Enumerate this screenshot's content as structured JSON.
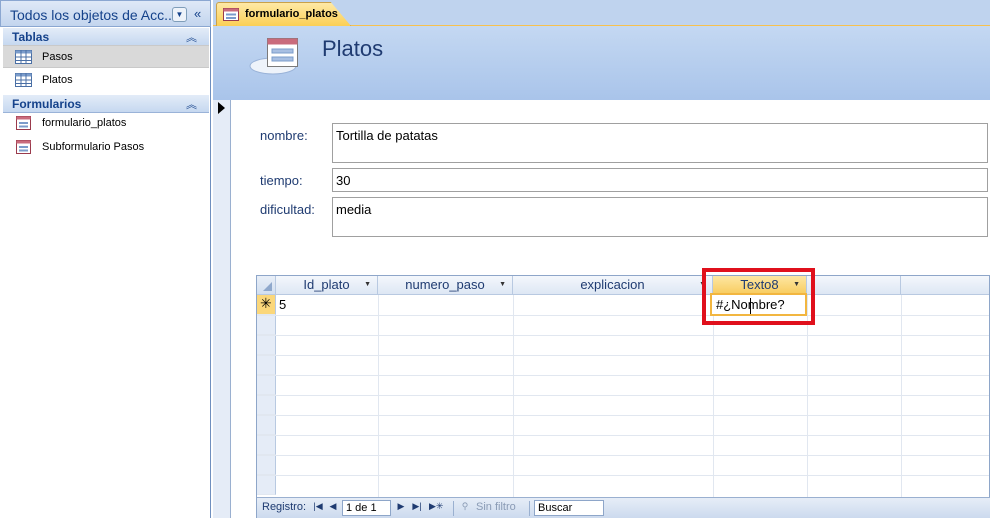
{
  "nav_pane": {
    "title": "Todos los objetos de Acc...",
    "groups": [
      {
        "label": "Tablas",
        "items": [
          "Pasos",
          "Platos"
        ]
      },
      {
        "label": "Formularios",
        "items": [
          "formulario_platos",
          "Subformulario Pasos"
        ]
      }
    ],
    "selected_item": "Pasos"
  },
  "document": {
    "tab_label": "formulario_platos",
    "form_title": "Platos"
  },
  "fields": [
    {
      "label": "nombre:",
      "value": "Tortilla de patatas"
    },
    {
      "label": "tiempo:",
      "value": "30"
    },
    {
      "label": "dificultad:",
      "value": "media"
    }
  ],
  "subform": {
    "columns": [
      "Id_plato",
      "numero_paso",
      "explicacion",
      "Texto8"
    ],
    "new_row": {
      "Id_plato": "5",
      "Texto8": "#¿Nombre?"
    },
    "new_row_marker": "✳"
  },
  "navbar": {
    "record_label": "Registro:",
    "record_counter": "1 de 1",
    "filter_label": "Sin filtro",
    "search_placeholder": "Buscar"
  },
  "colors": {
    "accent": "#f8cc5f",
    "annotation": "#e0101c",
    "header_blue": "#c4d8f2"
  }
}
